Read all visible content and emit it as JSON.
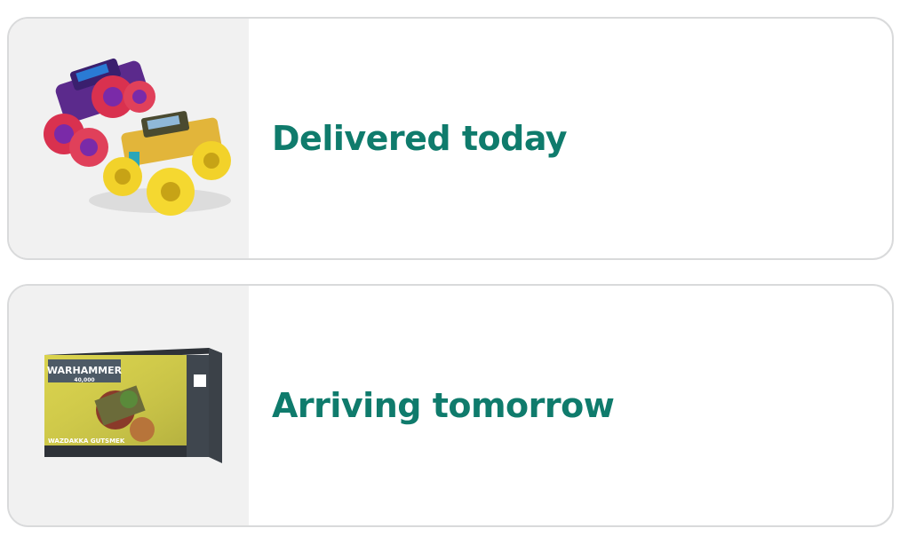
{
  "orders": [
    {
      "status": "Delivered today",
      "image": "monster-trucks-toy-image"
    },
    {
      "status": "Arriving tomorrow",
      "image": "warhammer-box-image",
      "box": {
        "title": "WARHAMMER",
        "subtitle": "40,000",
        "name": "WAZDAKKA GUTSMEK"
      }
    }
  ],
  "colors": {
    "status_text": "#0f7b6c",
    "card_border": "#d9dadb",
    "thumb_bg": "#f1f1f1"
  }
}
